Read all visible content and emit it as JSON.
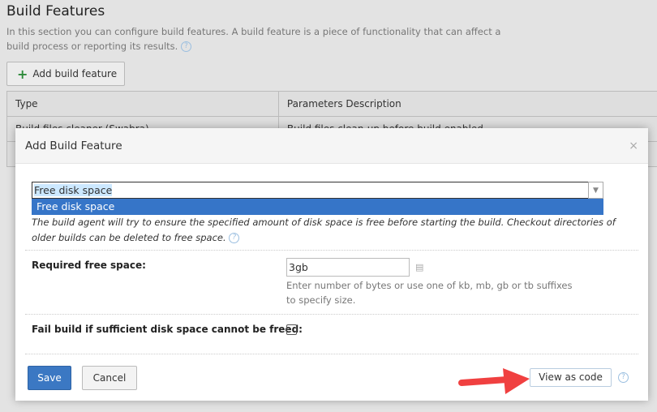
{
  "page": {
    "title": "Build Features",
    "description": "In this section you can configure build features. A build feature is a piece of functionality that can affect a build process or reporting its results.",
    "add_button": "Add build feature"
  },
  "table": {
    "headers": [
      "Type",
      "Parameters Description"
    ],
    "rows": [
      [
        "Build files cleaner (Swabra)",
        "Build files clean-up before build enabled"
      ]
    ]
  },
  "modal": {
    "title": "Add Build Feature",
    "close": "×",
    "feature_select": {
      "value": "Free disk space",
      "options": [
        "Free disk space"
      ],
      "highlighted": "Free disk space"
    },
    "feature_description": "The build agent will try to ensure the specified amount of disk space is free before starting the build. Checkout directories of older builds can be deleted to free space.",
    "required_free_space": {
      "label": "Required free space:",
      "value": "3gb",
      "hint_line1": "Enter number of bytes or use one of kb, mb, gb or tb suffixes",
      "hint_line2": "to specify size."
    },
    "fail_build": {
      "label": "Fail build if sufficient disk space cannot be freed:",
      "checked": false
    },
    "save": "Save",
    "cancel": "Cancel",
    "view_as_code": "View as code"
  },
  "colors": {
    "primary": "#3b78c3",
    "highlight": "#3675c8",
    "arrow": "#f04040"
  }
}
